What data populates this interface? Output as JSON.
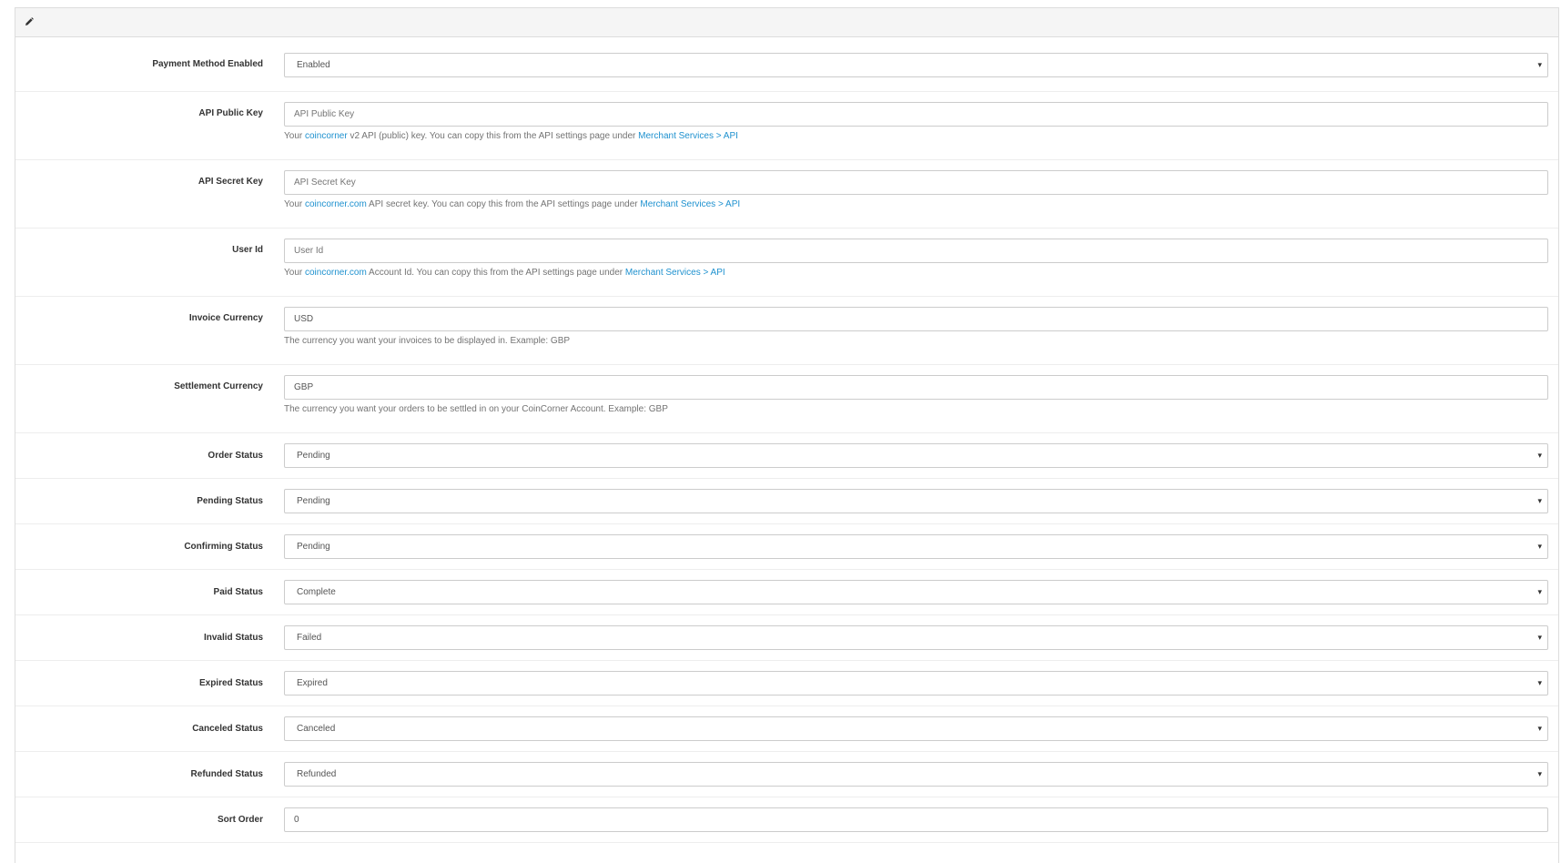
{
  "heading": {
    "icon": "pencil-icon"
  },
  "fields": {
    "payment_method_enabled": {
      "label": "Payment Method Enabled",
      "value": "Enabled"
    },
    "api_public_key": {
      "label": "API Public Key",
      "placeholder": "API Public Key",
      "help_prefix": "Your",
      "help_link1": "coincorner",
      "help_middle": "v2 API (public) key. You can copy this from the API settings page under",
      "help_link2": "Merchant Services > API"
    },
    "api_secret_key": {
      "label": "API Secret Key",
      "placeholder": "API Secret Key",
      "help_prefix": "Your",
      "help_link1": "coincorner.com",
      "help_middle": "API secret key. You can copy this from the API settings page under",
      "help_link2": "Merchant Services > API"
    },
    "user_id": {
      "label": "User Id",
      "placeholder": "User Id",
      "help_prefix": "Your",
      "help_link1": "coincorner.com",
      "help_middle": "Account Id. You can copy this from the API settings page under",
      "help_link2": "Merchant Services > API"
    },
    "invoice_currency": {
      "label": "Invoice Currency",
      "value": "USD",
      "help": "The currency you want your invoices to be displayed in. Example: GBP"
    },
    "settlement_currency": {
      "label": "Settlement Currency",
      "value": "GBP",
      "help": "The currency you want your orders to be settled in on your CoinCorner Account. Example: GBP"
    },
    "order_status": {
      "label": "Order Status",
      "value": "Pending"
    },
    "pending_status": {
      "label": "Pending Status",
      "value": "Pending"
    },
    "confirming_status": {
      "label": "Confirming Status",
      "value": "Pending"
    },
    "paid_status": {
      "label": "Paid Status",
      "value": "Complete"
    },
    "invalid_status": {
      "label": "Invalid Status",
      "value": "Failed"
    },
    "expired_status": {
      "label": "Expired Status",
      "value": "Expired"
    },
    "canceled_status": {
      "label": "Canceled Status",
      "value": "Canceled"
    },
    "refunded_status": {
      "label": "Refunded Status",
      "value": "Refunded"
    },
    "sort_order": {
      "label": "Sort Order",
      "value": "0"
    }
  },
  "caret_glyph": "▾",
  "colors": {
    "link": "#1e91cf",
    "heading_bg": "#f5f5f5",
    "border": "#cccccc"
  }
}
